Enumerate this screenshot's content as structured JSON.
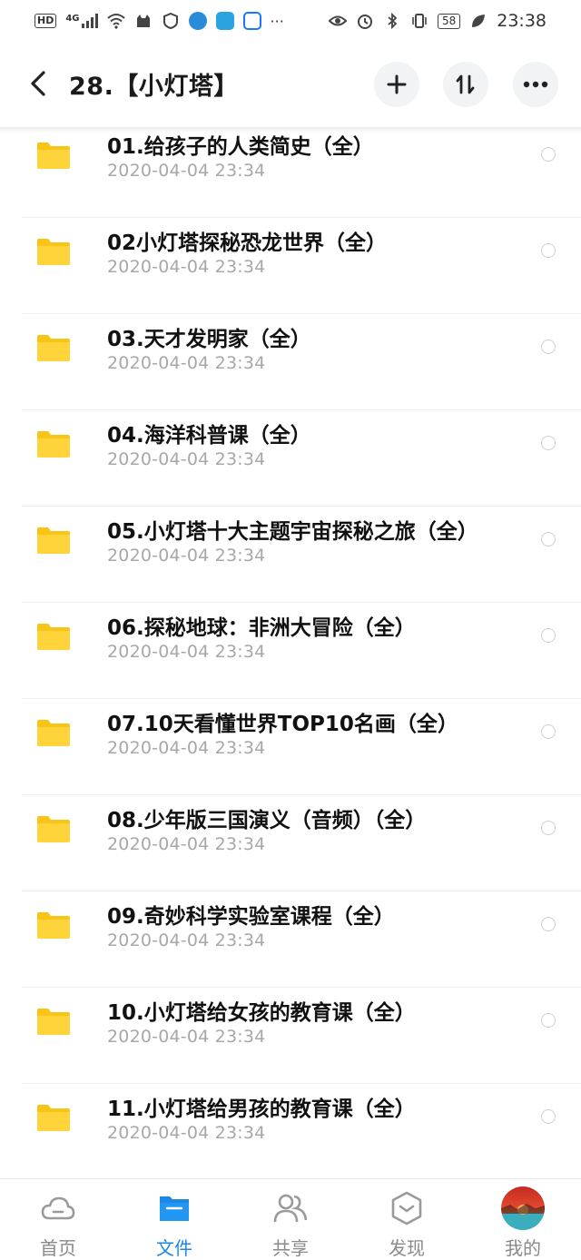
{
  "status_bar": {
    "hd_badge": "HD",
    "network": "4G",
    "battery": "58",
    "time": "23:38",
    "more": "···"
  },
  "header": {
    "title": "28.【小灯塔】",
    "back_icon": "chevron-left-icon",
    "actions": [
      "plus-icon",
      "sort-icon",
      "more-icon"
    ]
  },
  "files": [
    {
      "name": "01.给孩子的人类简史（全）",
      "date": "2020-04-04  23:34"
    },
    {
      "name": "02小灯塔探秘恐龙世界（全）",
      "date": "2020-04-04  23:34"
    },
    {
      "name": "03.天才发明家（全）",
      "date": "2020-04-04  23:34"
    },
    {
      "name": "04.海洋科普课（全）",
      "date": "2020-04-04  23:34"
    },
    {
      "name": "05.小灯塔十大主题宇宙探秘之旅（全）",
      "date": "2020-04-04  23:34"
    },
    {
      "name": "06.探秘地球：非洲大冒险（全）",
      "date": "2020-04-04  23:34"
    },
    {
      "name": "07.10天看懂世界TOP10名画（全）",
      "date": "2020-04-04  23:34"
    },
    {
      "name": "08.少年版三国演义（音频）（全）",
      "date": "2020-04-04  23:34"
    },
    {
      "name": "09.奇妙科学实验室课程（全）",
      "date": "2020-04-04  23:34"
    },
    {
      "name": "10.小灯塔给女孩的教育课（全）",
      "date": "2020-04-04  23:34"
    },
    {
      "name": "11.小灯塔给男孩的教育课（全）",
      "date": "2020-04-04  23:34"
    }
  ],
  "bottom_nav": [
    {
      "label": "首页",
      "icon": "cloud-icon",
      "active": false
    },
    {
      "label": "文件",
      "icon": "folder-icon",
      "active": true
    },
    {
      "label": "共享",
      "icon": "people-icon",
      "active": false
    },
    {
      "label": "发现",
      "icon": "discover-icon",
      "active": false
    },
    {
      "label": "我的",
      "icon": "avatar",
      "active": false
    }
  ],
  "colors": {
    "accent": "#1e88e5",
    "folder": "#ffd43b",
    "date_text": "#a8a8a8",
    "inactive_nav": "#8a8a8a"
  }
}
